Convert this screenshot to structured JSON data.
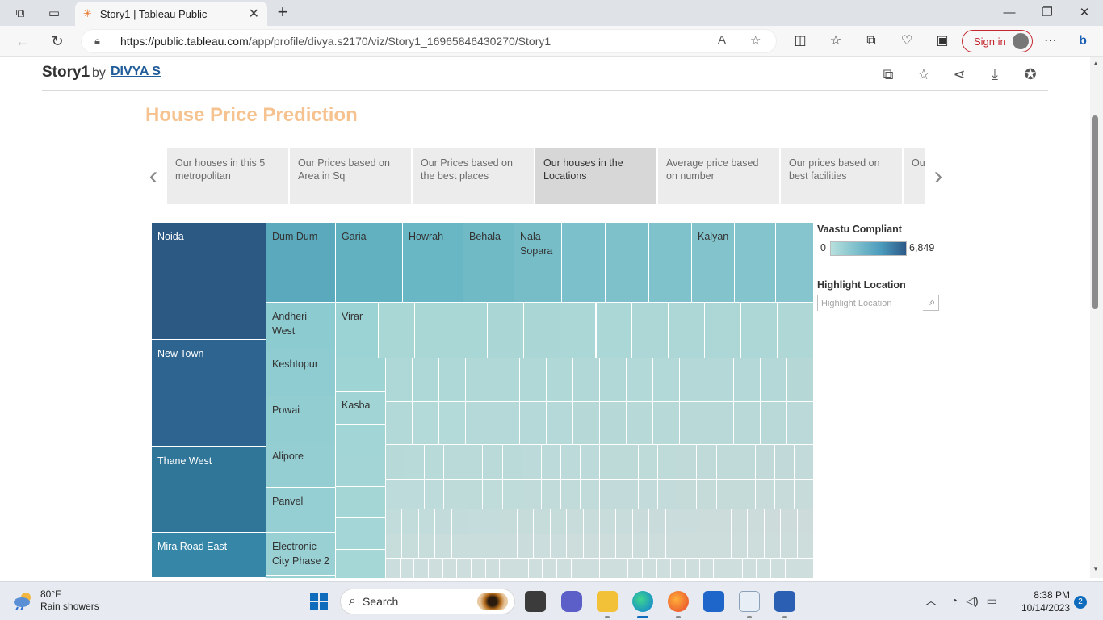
{
  "browser": {
    "tab_title": "Story1 | Tableau Public",
    "url_host": "https://public.tableau.com",
    "url_path": "/app/profile/divya.s2170/viz/Story1_16965846430270/Story1",
    "sign_in_label": "Sign in"
  },
  "viz": {
    "title": "Story1",
    "by": "by",
    "author": "DIVYA S"
  },
  "story": {
    "title": "House Price Prediction",
    "points": [
      {
        "label": "Our houses in this 5 metropolitan",
        "active": false
      },
      {
        "label": "Our Prices based on Area in Sq",
        "active": false
      },
      {
        "label": "Our Prices based on the best places",
        "active": false
      },
      {
        "label": "Our houses in the Locations",
        "active": true
      },
      {
        "label": "Average price based on number",
        "active": false
      },
      {
        "label": "Our prices based on best facilities",
        "active": false
      },
      {
        "label": "Our best",
        "active": false
      }
    ]
  },
  "legend": {
    "title": "Vaastu Compliant",
    "min": "0",
    "max": "6,849",
    "colors": [
      "#b7e0dd",
      "#7fc0cc",
      "#4b9bbd",
      "#2c5a88"
    ]
  },
  "highlight": {
    "title": "Highlight Location",
    "placeholder": "Highlight Location"
  },
  "treemap_labels": {
    "noida": "Noida",
    "new_town": "New Town",
    "thane_west": "Thane West",
    "mira_road_east": "Mira Road East",
    "dum_dum": "Dum Dum",
    "garia": "Garia",
    "howrah": "Howrah",
    "behala": "Behala",
    "nala_sopara": "Nala Sopara",
    "kalyan": "Kalyan",
    "andheri_west": "Andheri West",
    "virar": "Virar",
    "keshtopur": "Keshtopur",
    "kasba": "Kasba",
    "powai": "Powai",
    "alipore": "Alipore",
    "panvel": "Panvel",
    "electronic_city": "Electronic City Phase 2"
  },
  "taskbar": {
    "temperature": "80°F",
    "weather": "Rain showers",
    "search_label": "Search",
    "time": "8:38 PM",
    "date": "10/14/2023",
    "notifications": "2"
  }
}
